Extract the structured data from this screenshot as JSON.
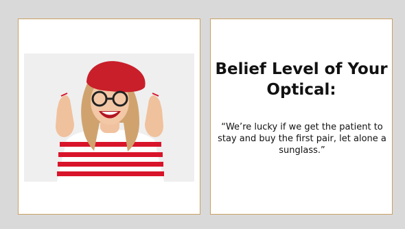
{
  "colors": {
    "background": "#d9d9d9",
    "panel_background": "#ffffff",
    "panel_border": "#c8a061",
    "text": "#111111",
    "beret_red": "#c91f2a",
    "stripe_red": "#d8142a"
  },
  "image": {
    "icon_name": "woman-fingers-crossed-photo"
  },
  "card": {
    "title": "Belief Level of Your Optical:",
    "quote": "“We’re lucky if we get the patient to stay and buy the first pair, let alone a sunglass.”"
  }
}
